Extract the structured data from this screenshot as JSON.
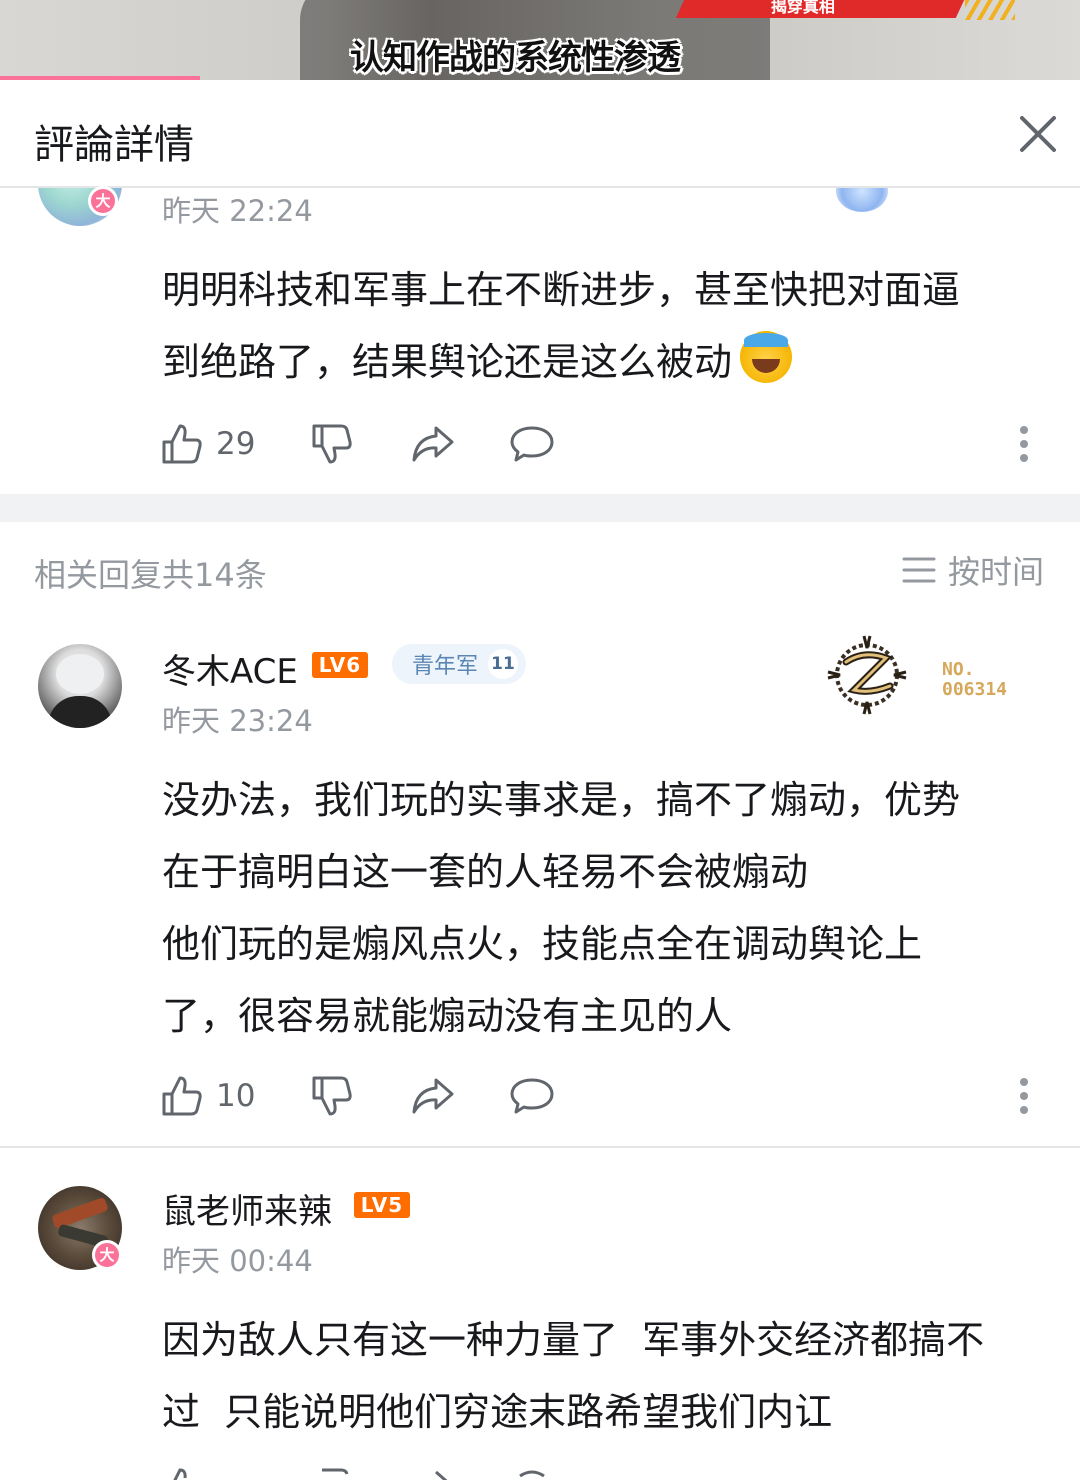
{
  "video": {
    "banner_text": "揭穿真相",
    "subtitle": "认知作战的系统性渗透"
  },
  "panel": {
    "title": "評論詳情"
  },
  "main_comment": {
    "time": "昨天 22:24",
    "avatar_badge": "大",
    "text_line1": "明明科技和军事上在不断进步，甚至快把对面逼",
    "text_line2": "到绝路了，结果舆论还是这么被动",
    "emoji": "😂",
    "likes": "29"
  },
  "replies_header": {
    "count_label": "相关回复共14条",
    "sort_label": "按时间"
  },
  "replies": [
    {
      "username": "冬木ACE",
      "level": "LV6",
      "medal_label": "青年军",
      "medal_level": "11",
      "fan_number_line1": "NO.",
      "fan_number_line2": "006314",
      "time": "昨天 23:24",
      "lines": [
        "没办法，我们玩的实事求是，搞不了煽动，优势",
        "在于搞明白这一套的人轻易不会被煽动",
        "他们玩的是煽风点火，技能点全在调动舆论上",
        "了，很容易就能煽动没有主见的人"
      ],
      "likes": "10"
    },
    {
      "username": "鼠老师来辣",
      "level": "LV5",
      "avatar_badge": "大",
      "time": "昨天 00:44",
      "lines": [
        "因为敌人只有这一种力量了  军事外交经济都搞不",
        "过  只能说明他们穷途末路希望我们内讧"
      ]
    }
  ],
  "colors": {
    "accent_pink": "#fb7299",
    "level_orange": "#ff6c00",
    "text_secondary": "#9499a0",
    "medal_blue": "#5b86b3"
  },
  "icons": [
    "like-icon",
    "dislike-icon",
    "share-icon",
    "reply-icon",
    "more-icon",
    "close-icon",
    "sort-icon"
  ]
}
